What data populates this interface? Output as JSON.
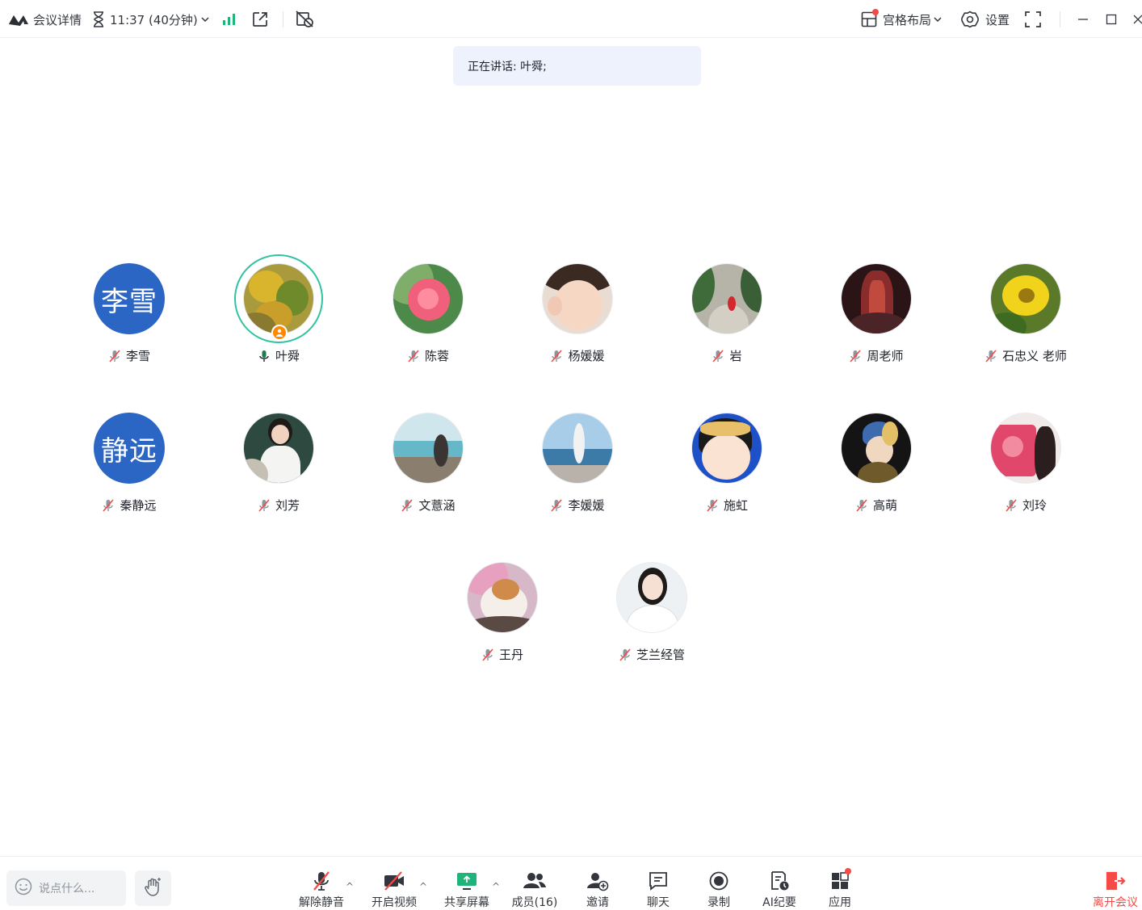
{
  "topbar": {
    "meeting_details_label": "会议详情",
    "timer_label": "11:37 (40分钟)",
    "layout_label": "宫格布局",
    "settings_label": "设置"
  },
  "speaker_banner": {
    "text": "正在讲话: 叶舜;"
  },
  "participants": [
    {
      "name": "李雪",
      "avatar_text": "李雪",
      "mic": "muted"
    },
    {
      "name": "叶舜",
      "mic": "on",
      "speaking": true,
      "host": true
    },
    {
      "name": "陈蓉",
      "mic": "muted"
    },
    {
      "name": "杨媛媛",
      "mic": "muted"
    },
    {
      "name": "岩",
      "mic": "muted"
    },
    {
      "name": "周老师",
      "mic": "muted"
    },
    {
      "name": "石忠义 老师",
      "mic": "muted"
    },
    {
      "name": "秦静远",
      "avatar_text": "静远",
      "mic": "muted"
    },
    {
      "name": "刘芳",
      "mic": "muted"
    },
    {
      "name": "文薏涵",
      "mic": "muted"
    },
    {
      "name": "李媛媛",
      "mic": "muted"
    },
    {
      "name": "施虹",
      "mic": "muted"
    },
    {
      "name": "高萌",
      "mic": "muted"
    },
    {
      "name": "刘玲",
      "mic": "muted"
    },
    {
      "name": "王丹",
      "mic": "muted"
    },
    {
      "name": "芝兰经管",
      "mic": "muted"
    }
  ],
  "bottombar": {
    "chat_placeholder": "说点什么...",
    "unmute_label": "解除静音",
    "start_video_label": "开启视频",
    "share_screen_label": "共享屏幕",
    "members_label": "成员(16)",
    "invite_label": "邀请",
    "chat_label": "聊天",
    "record_label": "录制",
    "ai_minutes_label": "AI纪要",
    "apps_label": "应用",
    "leave_label": "离开会议"
  },
  "colors": {
    "accent_blue": "#2b66c5",
    "speaking_ring": "#2fc3a0",
    "host_badge": "#ff8800",
    "danger": "#f54a45",
    "share_green": "#1fb57a",
    "banner_bg": "#edf2fd"
  },
  "icons": {
    "logo": "meeting-logo-icon",
    "timer": "hourglass-icon",
    "signal": "signal-bars-icon",
    "popout": "popout-icon",
    "filter": "no-filter-icon",
    "layout": "grid-layout-icon",
    "settings": "gear-icon",
    "fullscreen": "fullscreen-icon"
  }
}
